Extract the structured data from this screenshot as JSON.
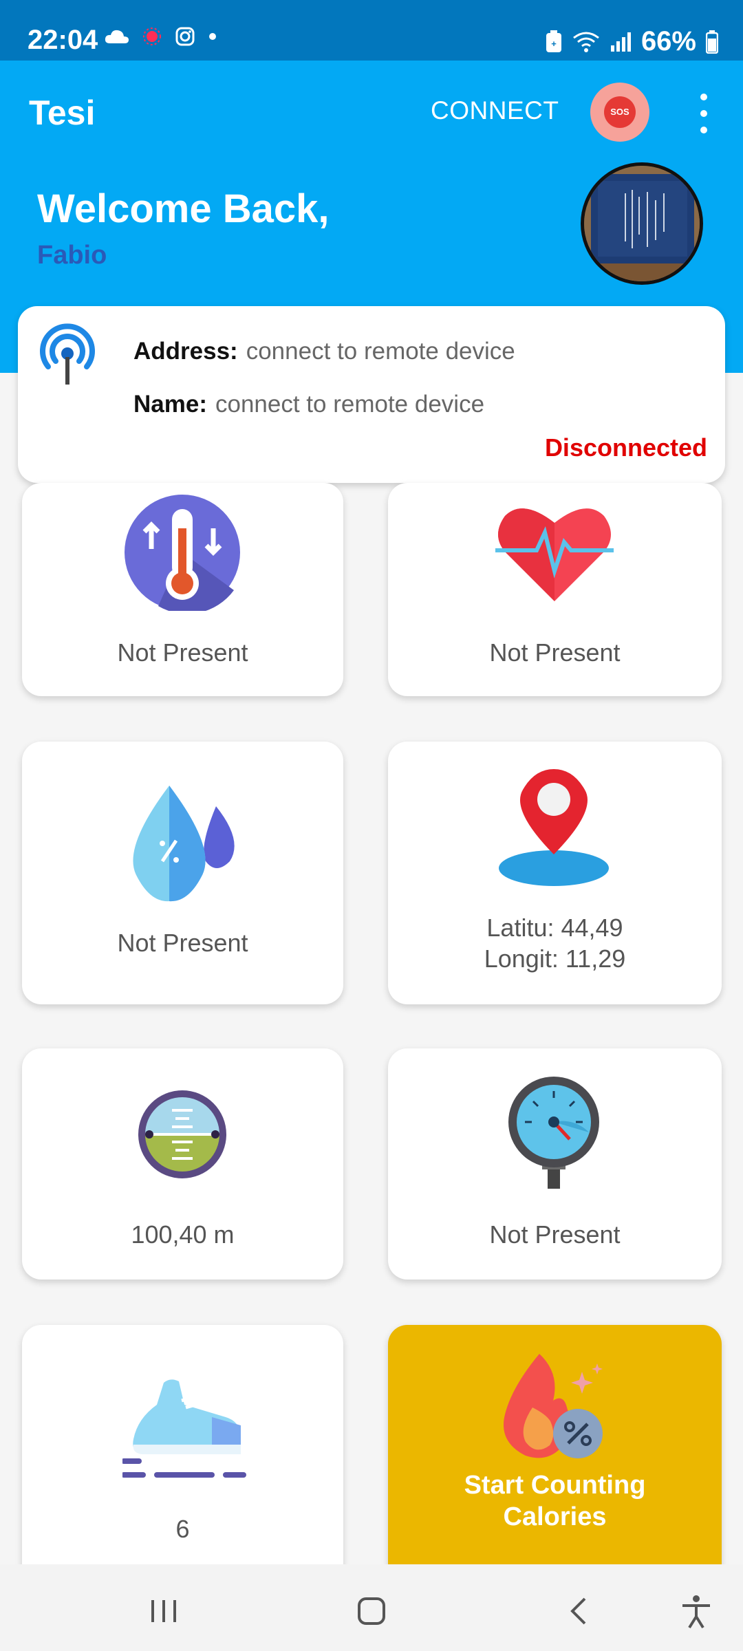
{
  "status_bar": {
    "time": "22:04",
    "battery": "66%"
  },
  "app_bar": {
    "title": "Tesi",
    "connect_label": "CONNECT",
    "sos_label": "SOS"
  },
  "header": {
    "welcome": "Welcome Back,",
    "user_name": "Fabio"
  },
  "device": {
    "address_label": "Address:",
    "address_value": "connect to remote device",
    "name_label": "Name:",
    "name_value": "connect to remote device",
    "status": "Disconnected",
    "status_color": "#e00000"
  },
  "tiles": {
    "temperature": "Not Present",
    "heart_rate": "Not Present",
    "humidity": "Not Present",
    "location_lat": "Latitu: 44,49",
    "location_lon": "Longit: 11,29",
    "altitude": "100,40 m",
    "pressure": "Not Present",
    "steps": "6",
    "calories_line1": "Start Counting",
    "calories_line2": "Calories"
  },
  "colors": {
    "app_bar": "#03a9f4",
    "status_bar": "#0277bd",
    "calories_tile": "#ebb700"
  }
}
